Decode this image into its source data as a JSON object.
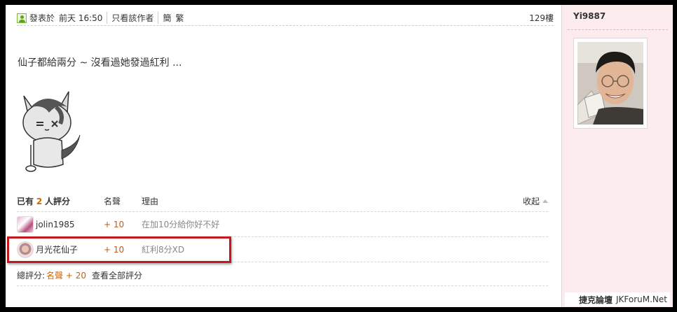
{
  "post": {
    "posted_label": "發表於",
    "posted_time": "前天  16:50",
    "only_author": "只看該作者",
    "simplified": "簡",
    "traditional": "繁",
    "floor": "129樓",
    "text": "仙子都給兩分 ~ 沒看過她發過紅利 ..."
  },
  "rating": {
    "header_prefix": "已有",
    "count": "2",
    "header_suffix": "人評分",
    "col_reputation": "名聲",
    "col_reason": "理由",
    "collapse": "收起",
    "rows": [
      {
        "user": "jolin1985",
        "score": "+ 10",
        "reason": "在加10分給你好不好"
      },
      {
        "user": "月光花仙子",
        "score": "+ 10",
        "reason": "紅利8分XD"
      }
    ],
    "total_label": "總評分:",
    "total_value": "名聲 + 20",
    "view_all": "查看全部評分"
  },
  "author": {
    "name": "Yi9887"
  },
  "watermark": {
    "brand": "捷克論壇",
    "site": "JKForuM.Net"
  },
  "colors": {
    "highlight": "#c8161d",
    "sidebar_bg": "#fdecee",
    "score": "#c05a1a"
  }
}
